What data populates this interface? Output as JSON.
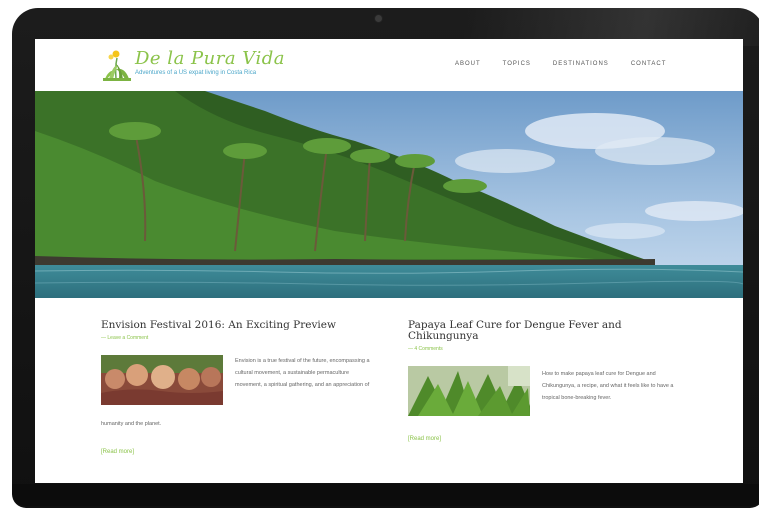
{
  "site": {
    "title": "De la Pura Vida",
    "tagline": "Adventures of a US expat living in Costa Rica"
  },
  "nav": {
    "items": [
      "ABOUT",
      "TOPICS",
      "DESTINATIONS",
      "CONTACT"
    ]
  },
  "posts": [
    {
      "title": "Envision Festival 2016: An Exciting Preview",
      "meta": "— Leave a Comment",
      "excerpt": "Envision is a true festival of the future, encompassing a cultural movement, a sustainable permaculture movement, a spiritual gathering, and an appreciation of",
      "excerpt_tail": "humanity and the planet.",
      "read_more": "[Read more]"
    },
    {
      "title": "Papaya Leaf Cure for Dengue Fever and Chikungunya",
      "meta": "— 4 Comments",
      "excerpt": "How to make papaya leaf cure for Dengue and Chikungunya, a recipe, and what it feels like to have a tropical bone-breaking fever.",
      "read_more": "[Read more]"
    }
  ],
  "colors": {
    "accent_green": "#8bc34a",
    "tagline_blue": "#4aa6c9",
    "frame": "#111111"
  }
}
